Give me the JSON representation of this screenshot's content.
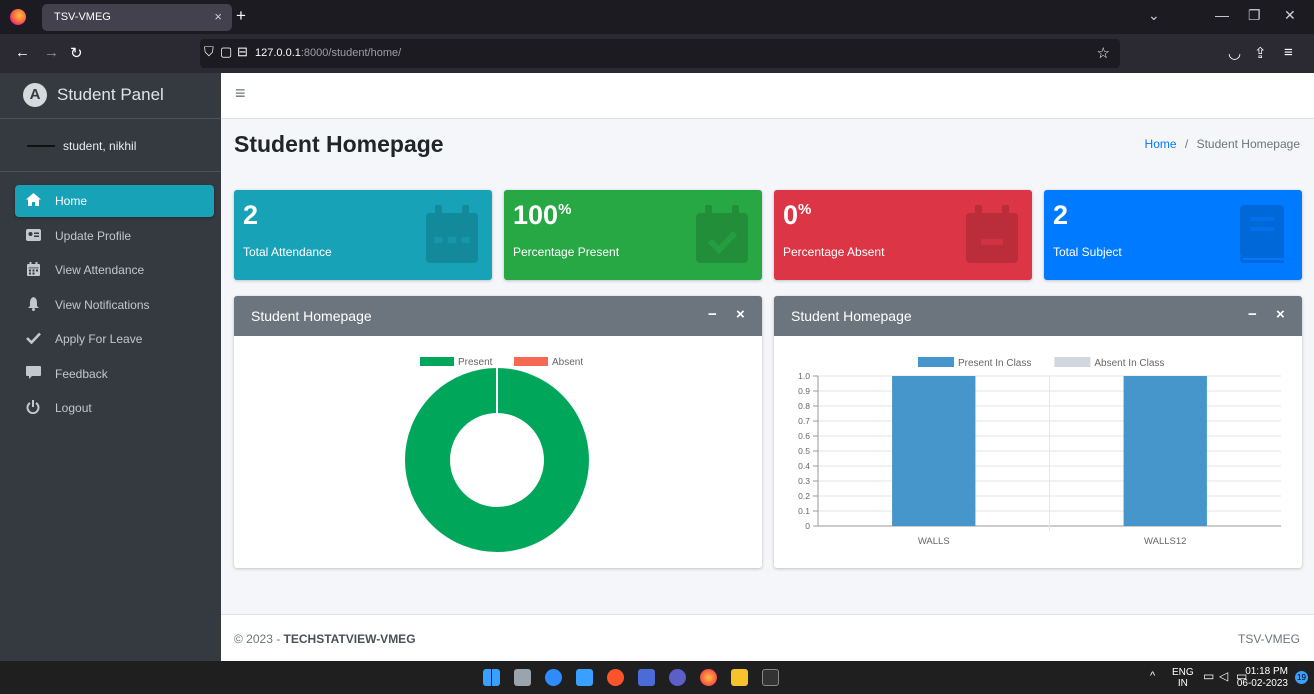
{
  "browser": {
    "tab_title": "TSV-VMEG",
    "tab_close": "×",
    "new_tab": "+",
    "url_host": "127.0.0.1",
    "url_path": ":8000/student/home/"
  },
  "sidebar": {
    "brand": "Student Panel",
    "brand_logo": "A",
    "user_name": "student, nikhil",
    "items": [
      {
        "label": "Home",
        "icon": "home-icon",
        "active": true
      },
      {
        "label": "Update Profile",
        "icon": "id-card-icon",
        "active": false
      },
      {
        "label": "View Attendance",
        "icon": "calendar-icon",
        "active": false
      },
      {
        "label": "View Notifications",
        "icon": "bell-icon",
        "active": false
      },
      {
        "label": "Apply For Leave",
        "icon": "check-icon",
        "active": false
      },
      {
        "label": "Feedback",
        "icon": "comment-icon",
        "active": false
      },
      {
        "label": "Logout",
        "icon": "power-icon",
        "active": false
      }
    ]
  },
  "page": {
    "title": "Student Homepage",
    "breadcrumb_home": "Home",
    "breadcrumb_sep": "/",
    "breadcrumb_current": "Student Homepage"
  },
  "boxes": [
    {
      "value": "2",
      "suffix": "",
      "label": "Total Attendance",
      "color": "#17a2b8",
      "icon": "calendar-icon"
    },
    {
      "value": "100",
      "suffix": "%",
      "label": "Percentage Present",
      "color": "#28a745",
      "icon": "calendar-check-icon"
    },
    {
      "value": "0",
      "suffix": "%",
      "label": "Percentage Absent",
      "color": "#dc3545",
      "icon": "calendar-minus-icon"
    },
    {
      "value": "2",
      "suffix": "",
      "label": "Total Subject",
      "color": "#007bff",
      "icon": "book-icon"
    }
  ],
  "cards": [
    {
      "title": "Student Homepage",
      "collapse": "−",
      "remove": "×"
    },
    {
      "title": "Student Homepage",
      "collapse": "−",
      "remove": "×"
    }
  ],
  "chart_data": [
    {
      "type": "pie",
      "legend": [
        {
          "name": "Present",
          "color": "#00a65a"
        },
        {
          "name": "Absent",
          "color": "#f56954"
        }
      ],
      "values": [
        100,
        0
      ],
      "donut": true
    },
    {
      "type": "bar",
      "categories": [
        "WALLS",
        "WALLS12"
      ],
      "series": [
        {
          "name": "Present In Class",
          "color": "#4796cb",
          "values": [
            1,
            1
          ]
        },
        {
          "name": "Absent In Class",
          "color": "#d2d6de",
          "values": [
            0,
            0
          ]
        }
      ],
      "ylim": [
        0,
        1.0
      ],
      "yticks": [
        "0",
        "0.1",
        "0.2",
        "0.3",
        "0.4",
        "0.5",
        "0.6",
        "0.7",
        "0.8",
        "0.9",
        "1.0"
      ],
      "grid": true,
      "legend_position": "top"
    }
  ],
  "footer": {
    "copyright": "© 2023 - ",
    "company": "TECHSTATVIEW-VMEG",
    "right": "TSV-VMEG"
  },
  "taskbar": {
    "lang_top": "ENG",
    "lang_bottom": "IN",
    "time": "01:18 PM",
    "date": "06-02-2023",
    "notifications": "19",
    "caret": "^"
  },
  "colors": {
    "sidebar": "#343a40",
    "active": "#17a2b8",
    "card_header": "#6c757d",
    "link": "#007bff"
  }
}
